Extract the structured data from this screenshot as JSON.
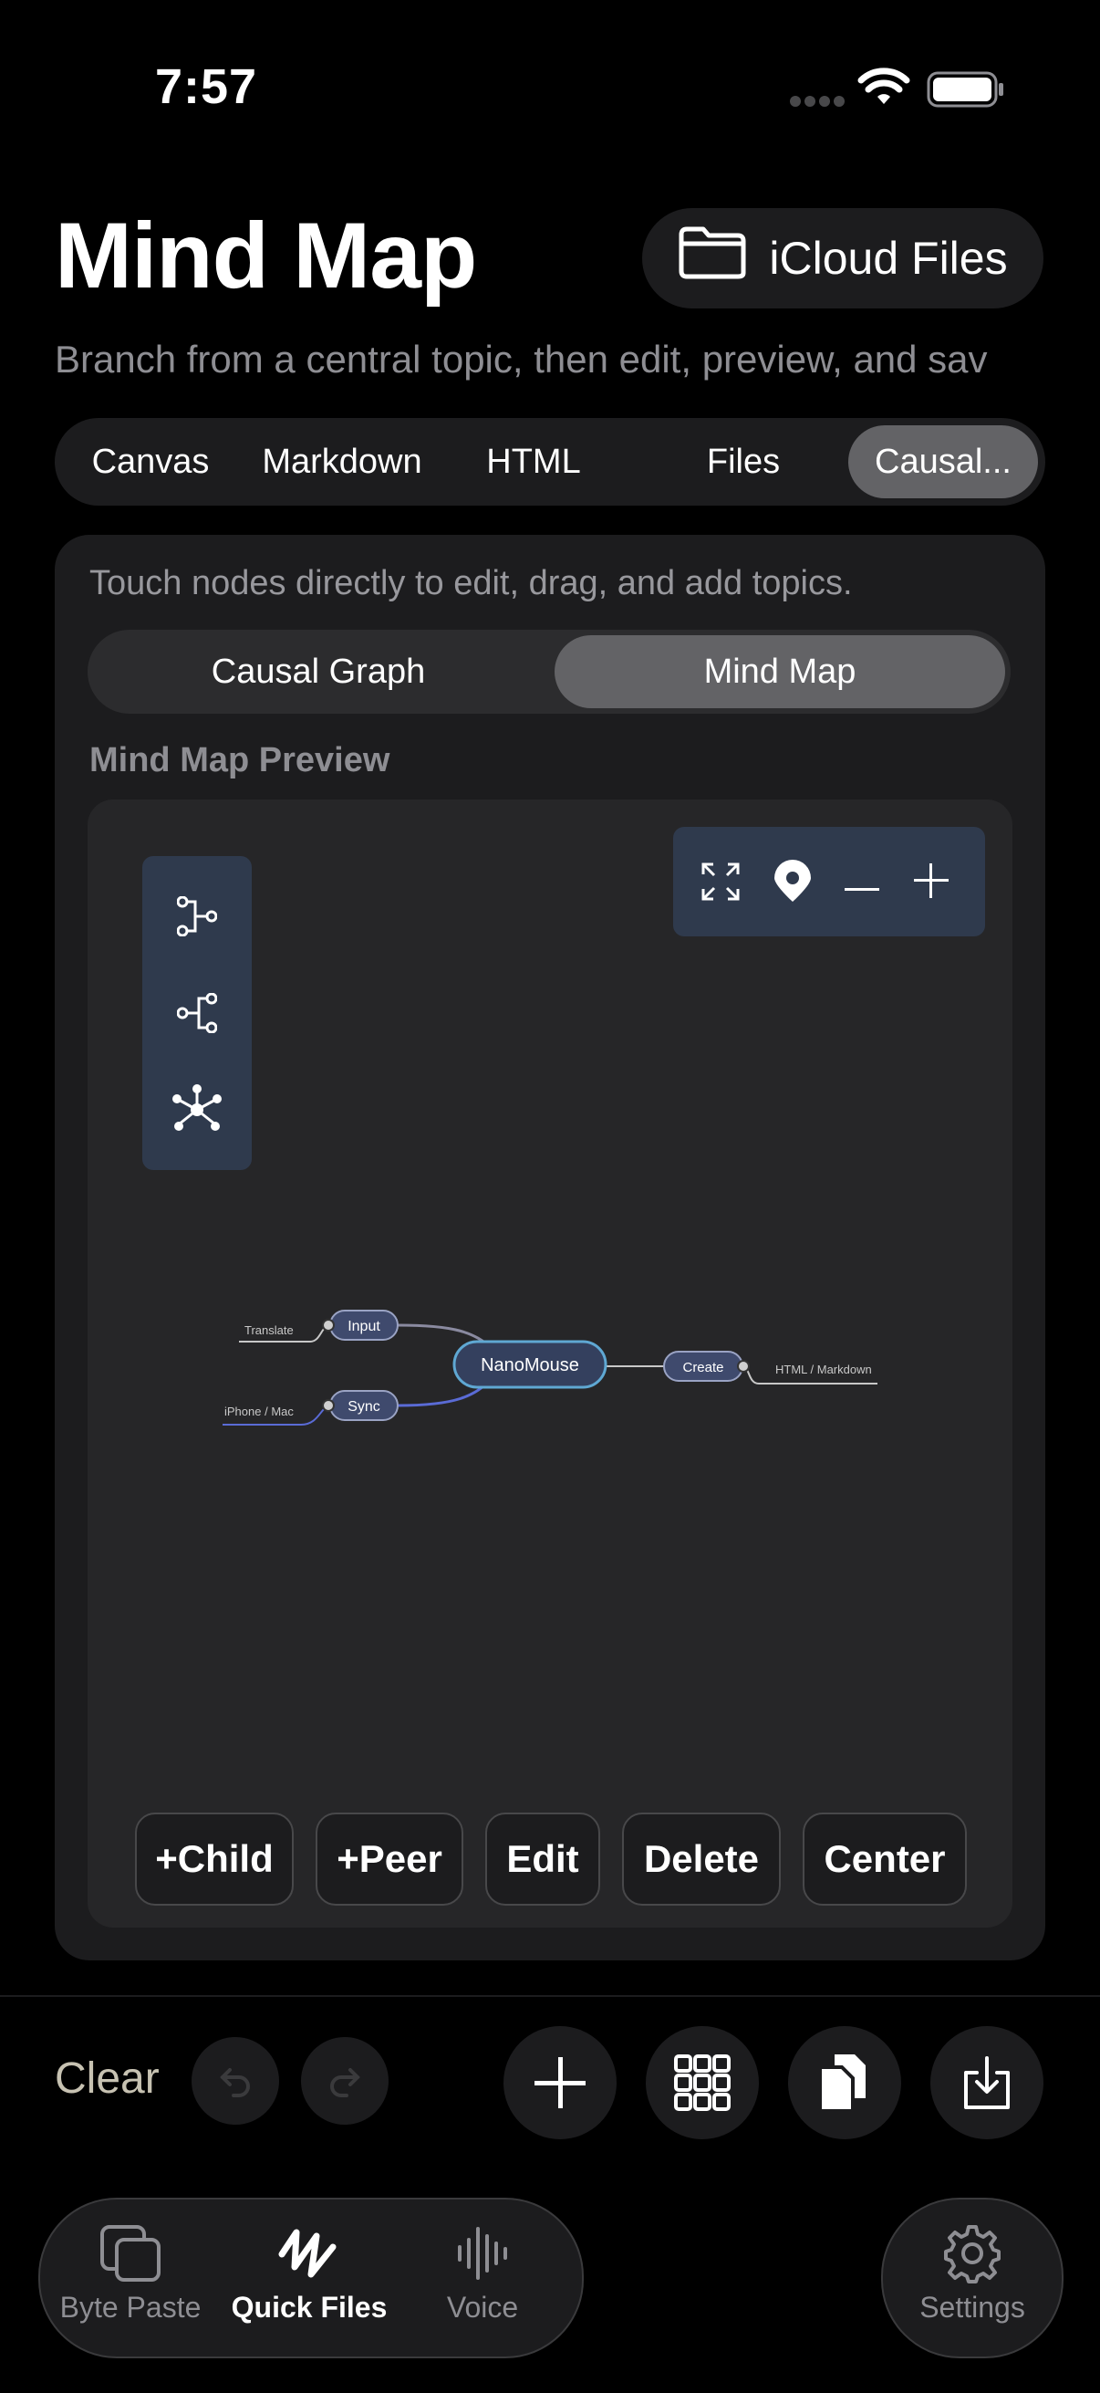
{
  "status": {
    "time": "7:57"
  },
  "header": {
    "title": "Mind Map",
    "icloud_label": "iCloud Files",
    "subtitle": "Branch from a central topic, then edit, preview, and sav"
  },
  "tabs": [
    {
      "label": "Canvas"
    },
    {
      "label": "Markdown"
    },
    {
      "label": "HTML"
    },
    {
      "label": "Files"
    },
    {
      "label": "Causal..."
    }
  ],
  "card": {
    "hint": "Touch nodes directly to edit, drag, and add topics.",
    "segments": [
      {
        "label": "Causal Graph"
      },
      {
        "label": "Mind Map"
      }
    ],
    "preview_label": "Mind Map Preview"
  },
  "mindmap": {
    "center": "NanoMouse",
    "nodes": [
      {
        "label": "Input"
      },
      {
        "label": "Sync"
      },
      {
        "label": "Create"
      }
    ],
    "leaves": [
      {
        "label": "Translate"
      },
      {
        "label": "iPhone / Mac"
      },
      {
        "label": "HTML / Markdown"
      }
    ]
  },
  "actions": [
    {
      "label": "+Child"
    },
    {
      "label": "+Peer"
    },
    {
      "label": "Edit"
    },
    {
      "label": "Delete"
    },
    {
      "label": "Center"
    }
  ],
  "toolbar": {
    "clear_label": "Clear"
  },
  "tabbar": {
    "items": [
      {
        "label": "Byte Paste"
      },
      {
        "label": "Quick Files"
      },
      {
        "label": "Voice"
      }
    ],
    "settings_label": "Settings"
  },
  "colors": {
    "accent_node": "#3f4a6d",
    "center_border": "#5fa8d3",
    "panel": "#2f3a4d"
  }
}
